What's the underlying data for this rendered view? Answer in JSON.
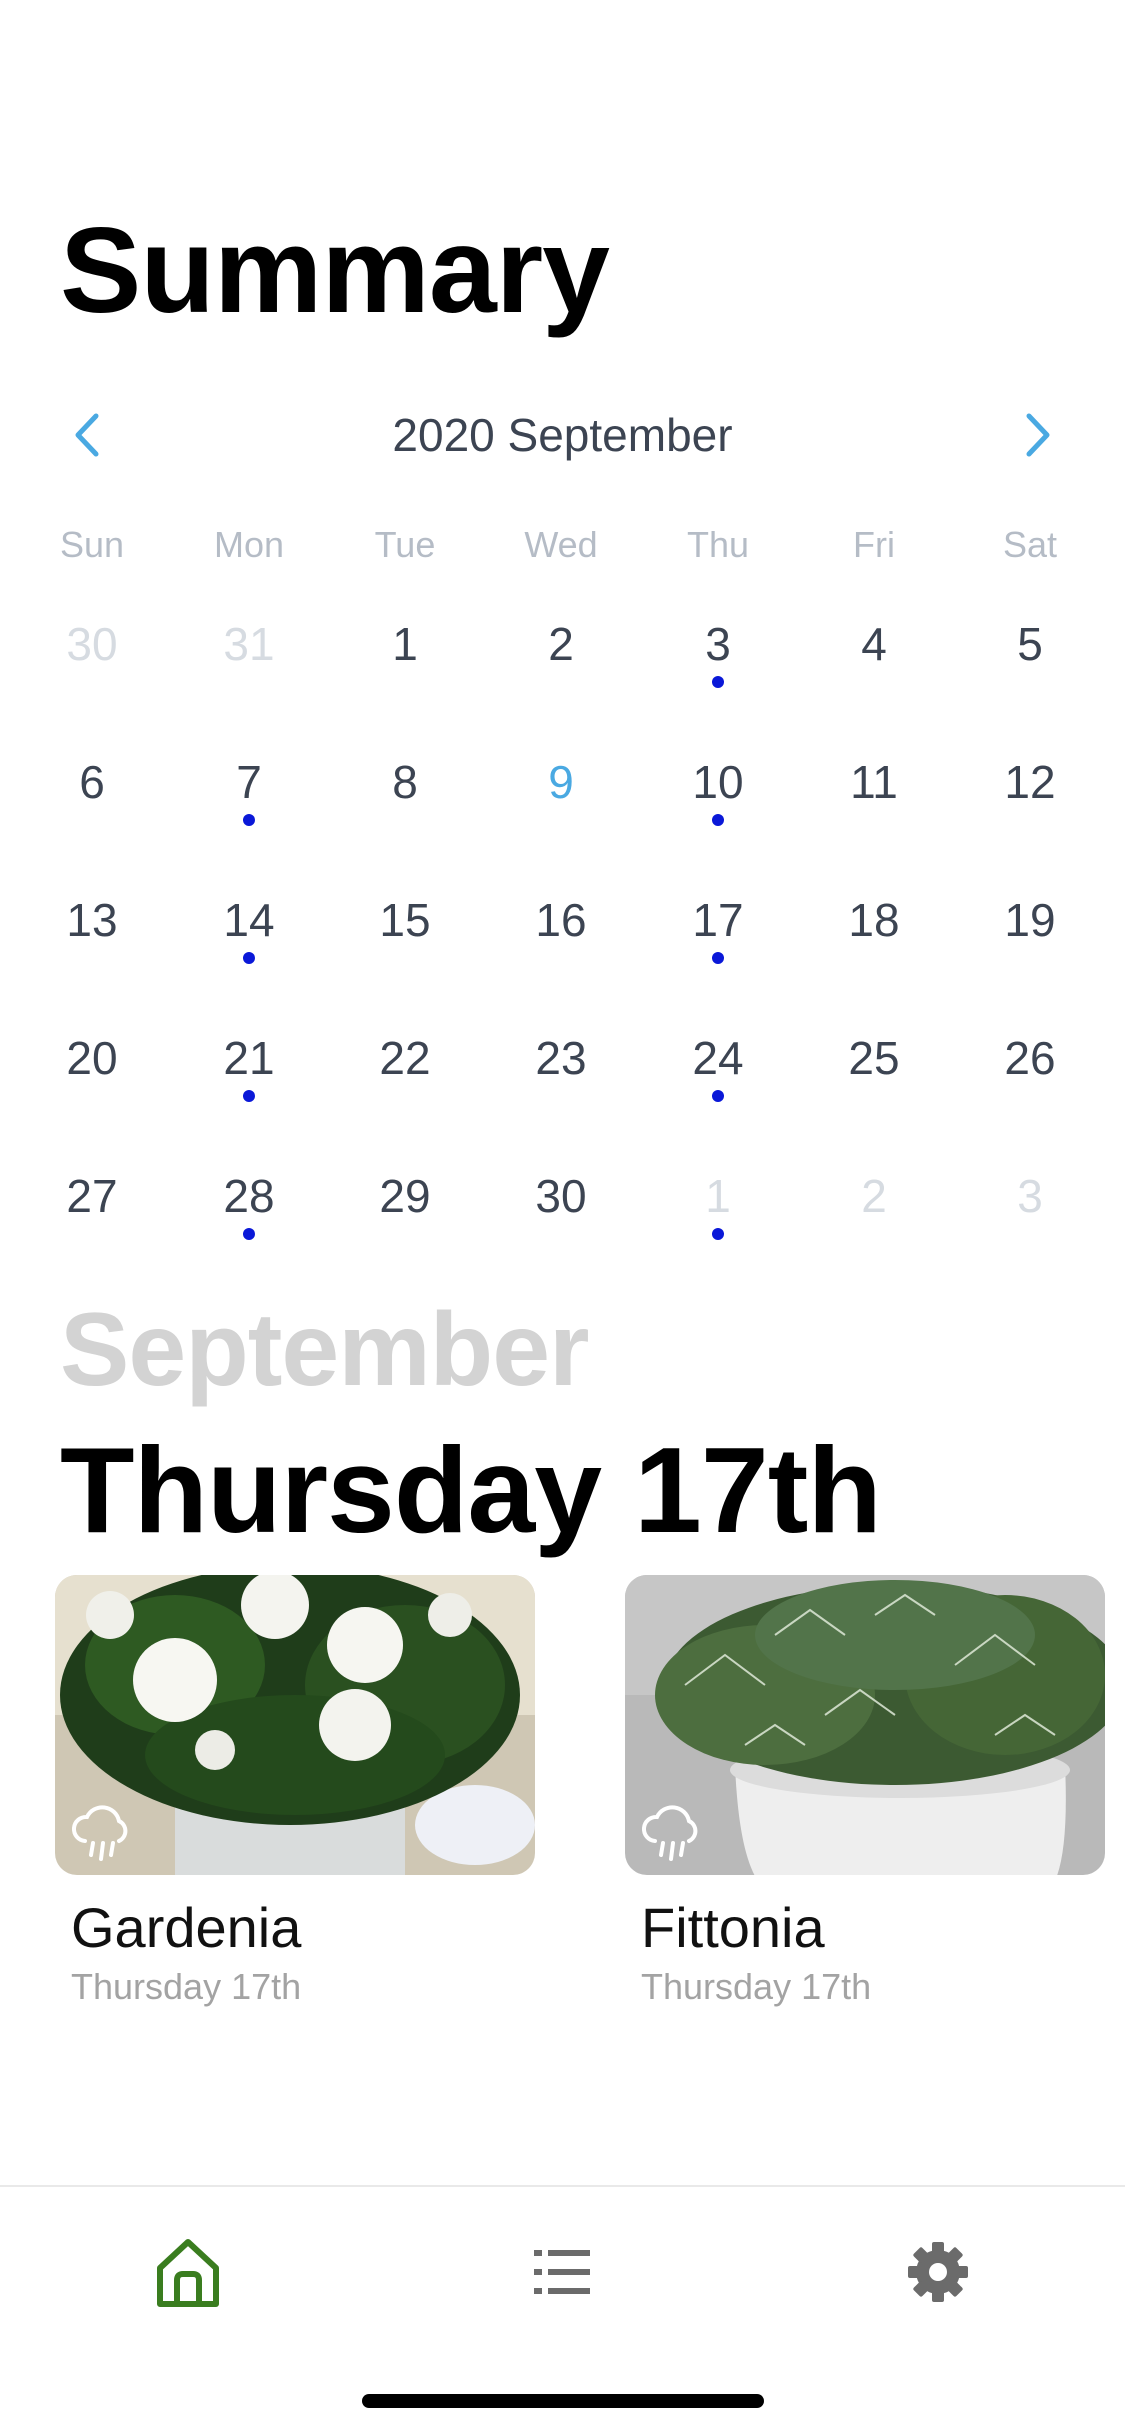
{
  "header": {
    "title": "Summary"
  },
  "calendar": {
    "month_label": "2020 September",
    "weekdays": [
      "Sun",
      "Mon",
      "Tue",
      "Wed",
      "Thu",
      "Fri",
      "Sat"
    ],
    "weeks": [
      [
        {
          "d": "30",
          "muted": true
        },
        {
          "d": "31",
          "muted": true
        },
        {
          "d": "1"
        },
        {
          "d": "2"
        },
        {
          "d": "3",
          "dot": true
        },
        {
          "d": "4"
        },
        {
          "d": "5"
        }
      ],
      [
        {
          "d": "6"
        },
        {
          "d": "7",
          "dot": true
        },
        {
          "d": "8"
        },
        {
          "d": "9",
          "today": true
        },
        {
          "d": "10",
          "dot": true
        },
        {
          "d": "11"
        },
        {
          "d": "12"
        }
      ],
      [
        {
          "d": "13"
        },
        {
          "d": "14",
          "dot": true
        },
        {
          "d": "15"
        },
        {
          "d": "16"
        },
        {
          "d": "17",
          "dot": true
        },
        {
          "d": "18"
        },
        {
          "d": "19"
        }
      ],
      [
        {
          "d": "20"
        },
        {
          "d": "21",
          "dot": true
        },
        {
          "d": "22"
        },
        {
          "d": "23"
        },
        {
          "d": "24",
          "dot": true
        },
        {
          "d": "25"
        },
        {
          "d": "26"
        }
      ],
      [
        {
          "d": "27"
        },
        {
          "d": "28",
          "dot": true
        },
        {
          "d": "29"
        },
        {
          "d": "30"
        },
        {
          "d": "1",
          "muted": true,
          "dot": true
        },
        {
          "d": "2",
          "muted": true
        },
        {
          "d": "3",
          "muted": true
        }
      ]
    ],
    "prev_icon": "chevron-left-icon",
    "next_icon": "chevron-right-icon"
  },
  "selected": {
    "month": "September",
    "date_label": "Thursday 17th"
  },
  "plants": [
    {
      "name": "Gardenia",
      "date": "Thursday 17th",
      "weather_icon": "rain-cloud-icon"
    },
    {
      "name": "Fittonia",
      "date": "Thursday 17th",
      "weather_icon": "rain-cloud-icon"
    }
  ],
  "tabbar": {
    "items": [
      {
        "icon": "home-icon",
        "active": true
      },
      {
        "icon": "list-icon",
        "active": false
      },
      {
        "icon": "gear-icon",
        "active": false
      }
    ]
  },
  "colors": {
    "accent": "#4aa9e2",
    "dot": "#0a18d8",
    "active_tab": "#3a7d1f",
    "inactive_tab": "#6b6b6b"
  }
}
